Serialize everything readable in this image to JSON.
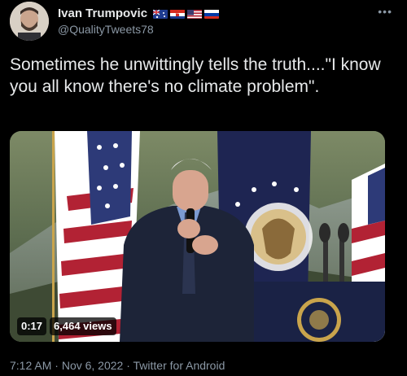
{
  "tweet": {
    "display_name": "Ivan Trumpovic",
    "handle": "@QualityTweets78",
    "flags": [
      "australia-flag",
      "croatia-flag",
      "usa-flag",
      "russia-flag"
    ],
    "text": "Sometimes he unwittingly tells the truth....\"I know you all know there's no climate problem\".",
    "more_icon": "•••",
    "media": {
      "duration": "0:17",
      "views": "6,464 views",
      "seal_text": "PRESIDENT OF THE UNITED STATES"
    },
    "meta": {
      "time": "7:12 AM",
      "separator": " · ",
      "date": "Nov 6, 2022",
      "source": "Twitter for Android"
    }
  },
  "colors": {
    "background": "#000000",
    "text": "#e7e9ea",
    "secondary_text": "#8b98a5"
  }
}
